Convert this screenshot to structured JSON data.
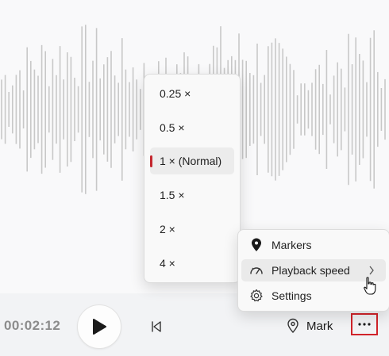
{
  "player": {
    "time": "00:02:12",
    "mark_label": "Mark",
    "more_label": "···"
  },
  "speed_menu": {
    "items": [
      "0.25 ×",
      "0.5 ×",
      "1 × (Normal)",
      "1.5 ×",
      "2 ×",
      "4 ×"
    ],
    "selected": "1 × (Normal)"
  },
  "context_menu": {
    "items": [
      {
        "label": "Markers",
        "icon": "marker-pin-icon"
      },
      {
        "label": "Playback speed",
        "icon": "speedometer-icon",
        "submenu": true
      },
      {
        "label": "Settings",
        "icon": "gear-icon"
      }
    ]
  },
  "colors": {
    "waveform": "#c8c8c8",
    "selection_indicator": "#c4262e",
    "highlight_border": "#d1232a"
  }
}
